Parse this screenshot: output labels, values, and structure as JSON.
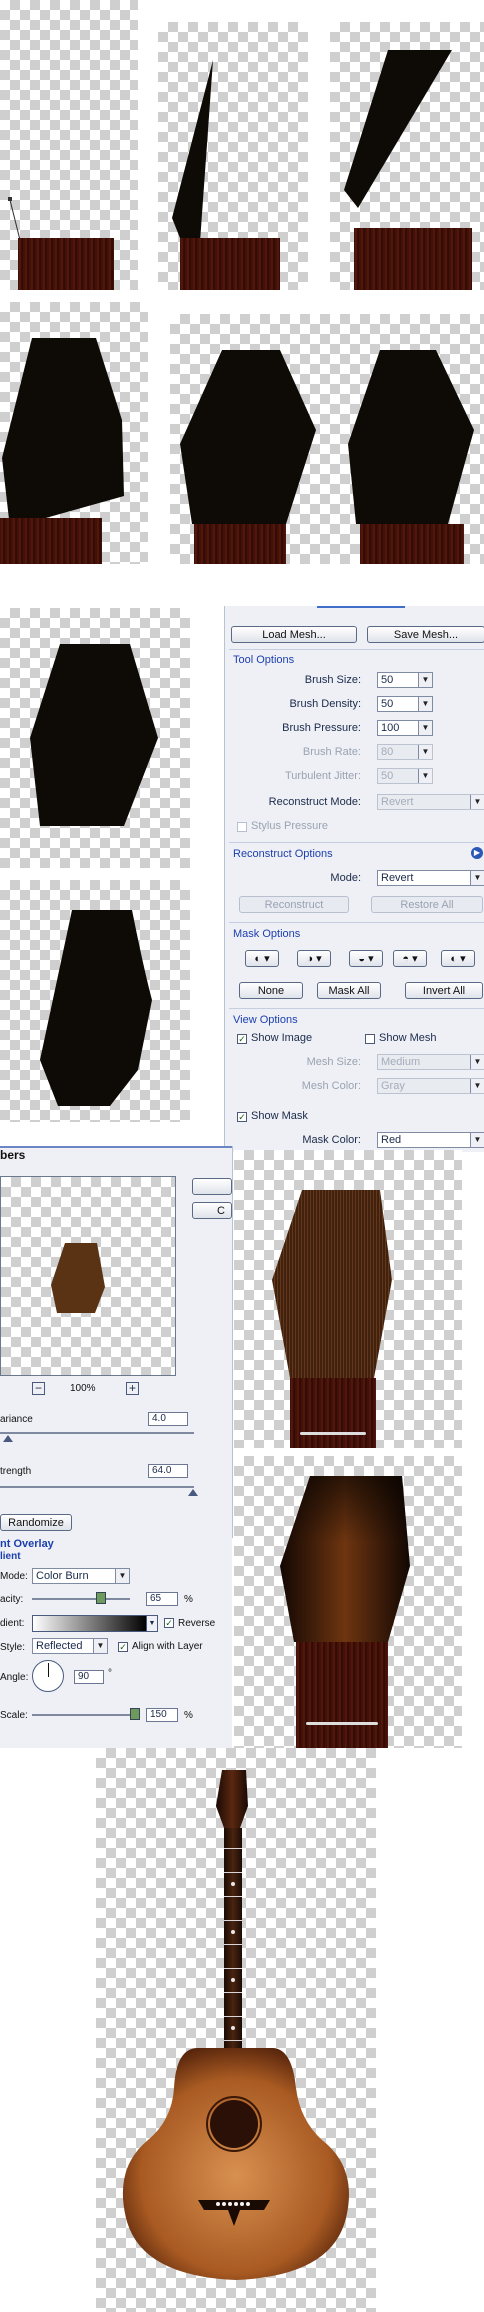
{
  "mesh_panel": {
    "load_mesh": "Load Mesh...",
    "save_mesh": "Save Mesh...",
    "tool_options": {
      "title": "Tool Options",
      "brush_size_label": "Brush Size:",
      "brush_size": "50",
      "brush_density_label": "Brush Density:",
      "brush_density": "50",
      "brush_pressure_label": "Brush Pressure:",
      "brush_pressure": "100",
      "brush_rate_label": "Brush Rate:",
      "brush_rate": "80",
      "turbulent_jitter_label": "Turbulent Jitter:",
      "turbulent_jitter": "50",
      "reconstruct_mode_label": "Reconstruct Mode:",
      "reconstruct_mode": "Revert",
      "stylus_pressure": "Stylus Pressure"
    },
    "reconstruct_options": {
      "title": "Reconstruct Options",
      "mode_label": "Mode:",
      "mode": "Revert",
      "reconstruct": "Reconstruct",
      "restore_all": "Restore All"
    },
    "mask_options": {
      "title": "Mask Options",
      "none": "None",
      "mask_all": "Mask All",
      "invert_all": "Invert All"
    },
    "view_options": {
      "title": "View Options",
      "show_image": "Show Image",
      "show_image_checked": true,
      "show_mesh": "Show Mesh",
      "show_mesh_checked": false,
      "mesh_size_label": "Mesh Size:",
      "mesh_size": "Medium",
      "mesh_color_label": "Mesh Color:",
      "mesh_color": "Gray",
      "show_mask": "Show Mask",
      "show_mask_checked": true,
      "mask_color_label": "Mask Color:",
      "mask_color": "Red"
    }
  },
  "fibers_dialog": {
    "title": "bers",
    "zoom": "100%",
    "variance_label": "ariance",
    "variance": "4.0",
    "strength_label": "trength",
    "strength": "64.0",
    "randomize": "Randomize",
    "ok_partial": "",
    "cancel_partial": "C"
  },
  "gradient_overlay": {
    "title": "nt Overlay",
    "subtitle": "lient",
    "mode_label": "Mode:",
    "mode": "Color Burn",
    "opacity_label": "acity:",
    "opacity": "65",
    "opacity_unit": "%",
    "gradient_label": "dient:",
    "reverse": "Reverse",
    "reverse_checked": true,
    "style_label": "Style:",
    "style": "Reflected",
    "align_with_layer": "Align with Layer",
    "align_checked": true,
    "angle_label": "Angle:",
    "angle": "90",
    "angle_unit": "°",
    "scale_label": "Scale:",
    "scale": "150",
    "scale_unit": "%"
  },
  "colors": {
    "shape_black": "#0e0a06",
    "wood_dark": "#3b0d06",
    "guitar_body": "#b0642a",
    "panel_bg": "#eef0f5",
    "section_title": "#1c3fae"
  }
}
